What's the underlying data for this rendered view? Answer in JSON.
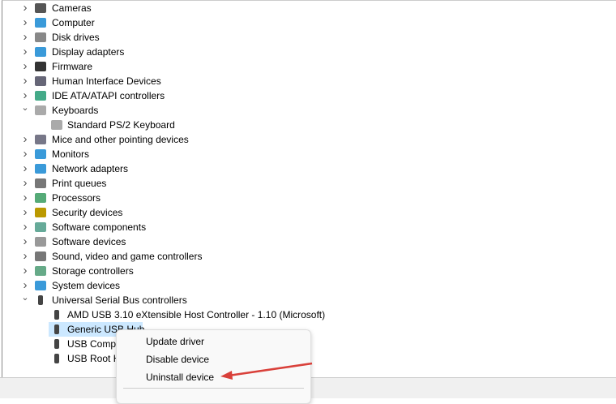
{
  "tree": [
    {
      "label": "Cameras",
      "expanded": false,
      "icon": "camera-icon",
      "color": "#555"
    },
    {
      "label": "Computer",
      "expanded": false,
      "icon": "computer-icon",
      "color": "#3a9ad9"
    },
    {
      "label": "Disk drives",
      "expanded": false,
      "icon": "disk-drive-icon",
      "color": "#888"
    },
    {
      "label": "Display adapters",
      "expanded": false,
      "icon": "display-adapter-icon",
      "color": "#3a9ad9"
    },
    {
      "label": "Firmware",
      "expanded": false,
      "icon": "firmware-icon",
      "color": "#333"
    },
    {
      "label": "Human Interface Devices",
      "expanded": false,
      "icon": "hid-icon",
      "color": "#667"
    },
    {
      "label": "IDE ATA/ATAPI controllers",
      "expanded": false,
      "icon": "ide-controller-icon",
      "color": "#4a8"
    },
    {
      "label": "Keyboards",
      "expanded": true,
      "icon": "keyboard-icon",
      "color": "#aaa"
    },
    {
      "label": "Standard PS/2 Keyboard",
      "child": true,
      "icon": "keyboard-icon",
      "color": "#aaa"
    },
    {
      "label": "Mice and other pointing devices",
      "expanded": false,
      "icon": "mouse-icon",
      "color": "#778"
    },
    {
      "label": "Monitors",
      "expanded": false,
      "icon": "monitor-icon",
      "color": "#3a9ad9"
    },
    {
      "label": "Network adapters",
      "expanded": false,
      "icon": "network-adapter-icon",
      "color": "#3a9ad9"
    },
    {
      "label": "Print queues",
      "expanded": false,
      "icon": "printer-icon",
      "color": "#777"
    },
    {
      "label": "Processors",
      "expanded": false,
      "icon": "processor-icon",
      "color": "#5a7"
    },
    {
      "label": "Security devices",
      "expanded": false,
      "icon": "security-device-icon",
      "color": "#b90"
    },
    {
      "label": "Software components",
      "expanded": false,
      "icon": "software-component-icon",
      "color": "#6a9"
    },
    {
      "label": "Software devices",
      "expanded": false,
      "icon": "software-device-icon",
      "color": "#999"
    },
    {
      "label": "Sound, video and game controllers",
      "expanded": false,
      "icon": "sound-icon",
      "color": "#777"
    },
    {
      "label": "Storage controllers",
      "expanded": false,
      "icon": "storage-controller-icon",
      "color": "#6a8"
    },
    {
      "label": "System devices",
      "expanded": false,
      "icon": "system-device-icon",
      "color": "#3a9ad9"
    },
    {
      "label": "Universal Serial Bus controllers",
      "expanded": true,
      "icon": "usb-icon",
      "color": "#444"
    },
    {
      "label": "AMD USB 3.10 eXtensible Host Controller - 1.10 (Microsoft)",
      "child": true,
      "icon": "usb-icon",
      "color": "#444"
    },
    {
      "label": "Generic USB Hub",
      "child": true,
      "selected": true,
      "icon": "usb-icon",
      "color": "#444"
    },
    {
      "label": "USB Composite Device",
      "child": true,
      "icon": "usb-icon",
      "color": "#444"
    },
    {
      "label": "USB Root Hub",
      "child": true,
      "icon": "usb-icon",
      "color": "#444"
    }
  ],
  "context_menu": {
    "items": [
      "Update driver",
      "Disable device",
      "Uninstall device"
    ]
  },
  "annotation_color": "#d9403a"
}
